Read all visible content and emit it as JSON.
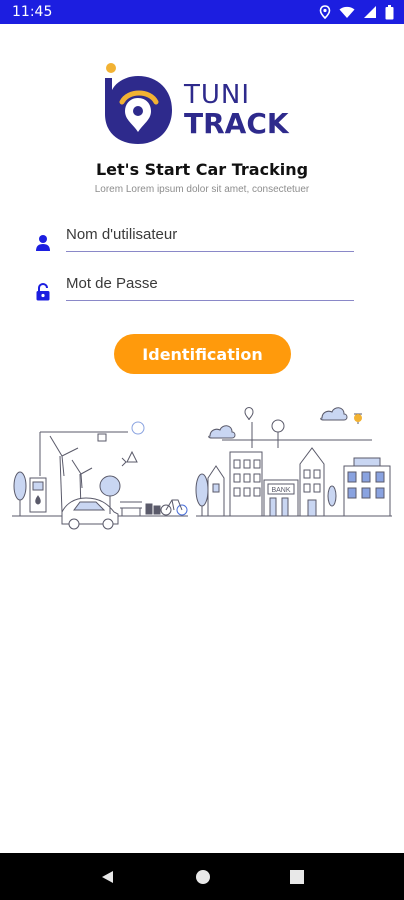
{
  "status_bar": {
    "time": "11:45",
    "icons": [
      "location-icon",
      "wifi-icon",
      "signal-icon",
      "battery-icon"
    ],
    "background": "#1c1ee0"
  },
  "logo": {
    "line1": "TUNI",
    "line2": "TRACK",
    "brand_color": "#2e2a8c",
    "accent_color": "#f2b233"
  },
  "headline": "Let's Start Car Tracking",
  "subline": "Lorem Lorem ipsum dolor sit amet, consectetuer",
  "form": {
    "username": {
      "placeholder": "Nom d'utilisateur",
      "value": "",
      "icon": "user-icon"
    },
    "password": {
      "placeholder": "Mot de Passe",
      "value": "",
      "icon": "lock-icon"
    }
  },
  "login_button": {
    "label": "Identification",
    "color": "#ff9a0c"
  },
  "illustration": {
    "bank_sign": "BANK"
  },
  "nav_bar": {
    "buttons": [
      "back-icon",
      "home-icon",
      "recents-icon"
    ]
  }
}
